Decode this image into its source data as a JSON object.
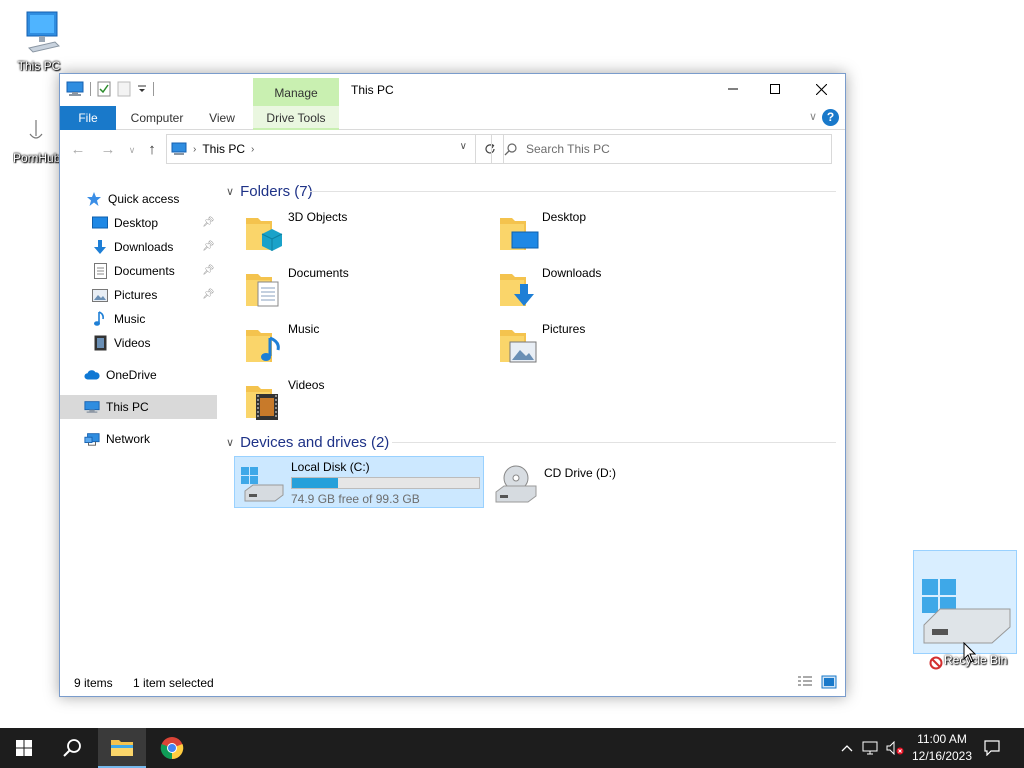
{
  "desktop": {
    "icons": [
      {
        "label": "This PC",
        "icon": "computer-icon"
      },
      {
        "label": "PornHub",
        "icon": "shortcut-icon"
      }
    ]
  },
  "window": {
    "title": "This PC",
    "contextual_tab": "Manage",
    "ribbon_tabs": [
      "File",
      "Computer",
      "View",
      "Drive Tools"
    ],
    "help_label": "?",
    "address": {
      "crumb": "This PC"
    },
    "search": {
      "placeholder": "Search This PC"
    },
    "nav": {
      "items": [
        {
          "label": "Quick access",
          "icon": "star-icon",
          "pinned": false
        },
        {
          "label": "Desktop",
          "icon": "desktop-icon",
          "pinned": true
        },
        {
          "label": "Downloads",
          "icon": "download-arrow-icon",
          "pinned": true
        },
        {
          "label": "Documents",
          "icon": "document-icon",
          "pinned": true
        },
        {
          "label": "Pictures",
          "icon": "pictures-icon",
          "pinned": true
        },
        {
          "label": "Music",
          "icon": "music-note-icon",
          "pinned": false
        },
        {
          "label": "Videos",
          "icon": "film-icon",
          "pinned": false
        },
        {
          "label": "OneDrive",
          "icon": "cloud-icon",
          "pinned": false
        },
        {
          "label": "This PC",
          "icon": "computer-icon",
          "pinned": false,
          "selected": true
        },
        {
          "label": "Network",
          "icon": "network-icon",
          "pinned": false
        }
      ]
    },
    "folders_header": "Folders (7)",
    "folders": [
      {
        "name": "3D Objects",
        "icon": "3d-objects-folder-icon"
      },
      {
        "name": "Desktop",
        "icon": "desktop-folder-icon"
      },
      {
        "name": "Documents",
        "icon": "documents-folder-icon"
      },
      {
        "name": "Downloads",
        "icon": "downloads-folder-icon"
      },
      {
        "name": "Music",
        "icon": "music-folder-icon"
      },
      {
        "name": "Pictures",
        "icon": "pictures-folder-icon"
      },
      {
        "name": "Videos",
        "icon": "videos-folder-icon"
      }
    ],
    "drives_header": "Devices and drives (2)",
    "drives": [
      {
        "name": "Local Disk (C:)",
        "free_text": "74.9 GB free of 99.3 GB",
        "used_fraction": 0.246,
        "selected": true
      },
      {
        "name": "CD Drive (D:)"
      }
    ],
    "status": {
      "items": "9 items",
      "selected": "1 item selected"
    }
  },
  "drag": {
    "label": "Recycle Bin"
  },
  "taskbar": {
    "time": "11:00 AM",
    "date": "12/16/2023"
  },
  "colors": {
    "accent": "#1979ca",
    "selection": "#cce8ff",
    "manage_tab": "#c9f0b1",
    "progress": "#26a0da"
  }
}
